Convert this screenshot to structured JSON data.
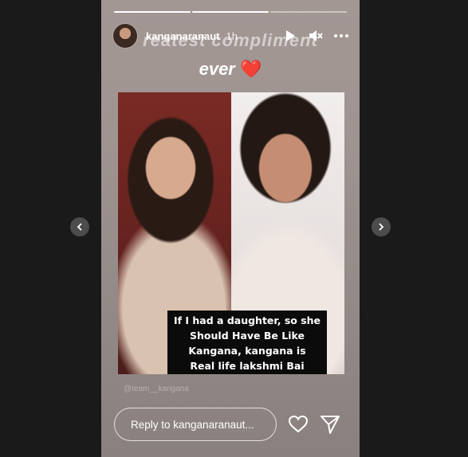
{
  "story": {
    "username": "kanganaranaut",
    "time": "1h",
    "progress": [
      1,
      1,
      0
    ],
    "caption_line1": "reatest compliment",
    "caption_line2": "ever",
    "heart": "❤️",
    "overlay_lines": [
      "If I had a daughter, so she",
      "Should Have Be  Like",
      "Kangana, kangana is",
      "Real life  lakshmi Bai"
    ],
    "watermark": "@team__kangana",
    "reply_placeholder": "Reply to kanganaranaut..."
  },
  "icons": {
    "play": "play-icon",
    "mute": "speaker-muted-icon",
    "more": "more-horizontal-icon",
    "like": "heart-outline-icon",
    "send": "paper-plane-icon",
    "prev": "chevron-left-icon",
    "next": "chevron-right-icon"
  },
  "colors": {
    "heart": "#e0243a",
    "page_bg": "#1a1a1a"
  }
}
